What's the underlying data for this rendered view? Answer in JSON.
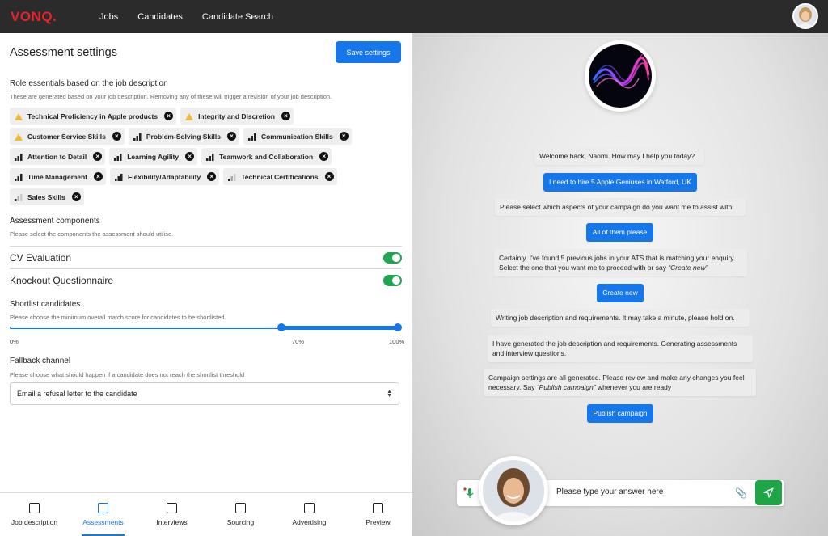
{
  "brand": {
    "logo": "VONQ.",
    "accent": "#1677ea",
    "logo_color": "#e8222b",
    "success": "#23a454"
  },
  "nav": {
    "links": [
      "Jobs",
      "Candidates",
      "Candidate Search"
    ]
  },
  "settings": {
    "title": "Assessment settings",
    "save_label": "Save settings",
    "role_title": "Role essentials based on the job description",
    "role_sub": "These are generated based on your job description. Removing any of these will trigger a revision of your job description.",
    "chips": [
      [
        {
          "label": "Technical Proficiency in Apple products",
          "icon": "warning-icon"
        },
        {
          "label": "Integrity and Discretion",
          "icon": "warning-icon"
        }
      ],
      [
        {
          "label": "Customer Service Skills",
          "icon": "warning-icon"
        },
        {
          "label": "Problem-Solving Skills",
          "icon": "level-high-icon"
        },
        {
          "label": "Communication Skills",
          "icon": "level-high-icon"
        }
      ],
      [
        {
          "label": "Attention to Detail",
          "icon": "level-high-icon"
        },
        {
          "label": "Learning Agility",
          "icon": "level-high-icon"
        },
        {
          "label": "Teamwork and Collaboration",
          "icon": "level-high-icon"
        }
      ],
      [
        {
          "label": "Time Management",
          "icon": "level-high-icon"
        },
        {
          "label": "Flexibility/Adaptability",
          "icon": "level-high-icon"
        },
        {
          "label": "Technical Certifications",
          "icon": "level-low-icon"
        }
      ],
      [
        {
          "label": "Sales Skills",
          "icon": "level-low-icon"
        }
      ]
    ],
    "components_title": "Assessment components",
    "components_sub": "Please select the components the assessment should utilise.",
    "cv_label": "CV Evaluation",
    "cv_enabled": true,
    "knockout_label": "Knockout Questionnaire",
    "knockout_enabled": true,
    "shortlist_title": "Shortlist candidates",
    "shortlist_sub": "Please choose the minimum overall match score for candidates to be shortlisted",
    "slider_min": 0,
    "slider_low": 70,
    "slider_high": 100,
    "tick_min": "0%",
    "tick_low": "70%",
    "tick_max": "100%",
    "fallback_title": "Fallback channel",
    "fallback_sub": "Please choose what should happen if a candidate does not reach the shortlist threshold",
    "fallback_value": "Email a refusal letter to the candidate"
  },
  "tabs": [
    {
      "label": "Job description",
      "icon": "download-icon"
    },
    {
      "label": "Assessments",
      "icon": "chart-icon",
      "active": true
    },
    {
      "label": "Interviews",
      "icon": "interview-icon"
    },
    {
      "label": "Sourcing",
      "icon": "sourcing-icon"
    },
    {
      "label": "Advertising",
      "icon": "megaphone-icon"
    },
    {
      "label": "Preview",
      "icon": "play-icon"
    }
  ],
  "chat": {
    "m1": "Welcome back, Naomi. How may I help you today?",
    "u1": "I need to hire 5 Apple Geniuses in Watford, UK",
    "m2": "Please select which aspects of your campaign do you want me to assist with",
    "u2": "All of them please",
    "m3a": "Certainly. I've found 5 previous jobs in your ATS that is matching your enquiry.",
    "m3b": "Select the one that you want me to proceed with or say ",
    "m3c": "“Create new”",
    "u3": "Create new",
    "m4": "Writing job description and requirements. It may take a minute, please hold on.",
    "m5a": "I have generated the job description and requirements. Generating assessments",
    "m5b": "and interview questions.",
    "m6a": "Campaign settings are all generated. Please review and make any changes you feel",
    "m6b": "necessary. Say ",
    "m6c": "“Publish campaign”",
    "m6d": " whenever you are ready",
    "u4": "Publish campaign",
    "input_placeholder": "Please type your answer here"
  }
}
